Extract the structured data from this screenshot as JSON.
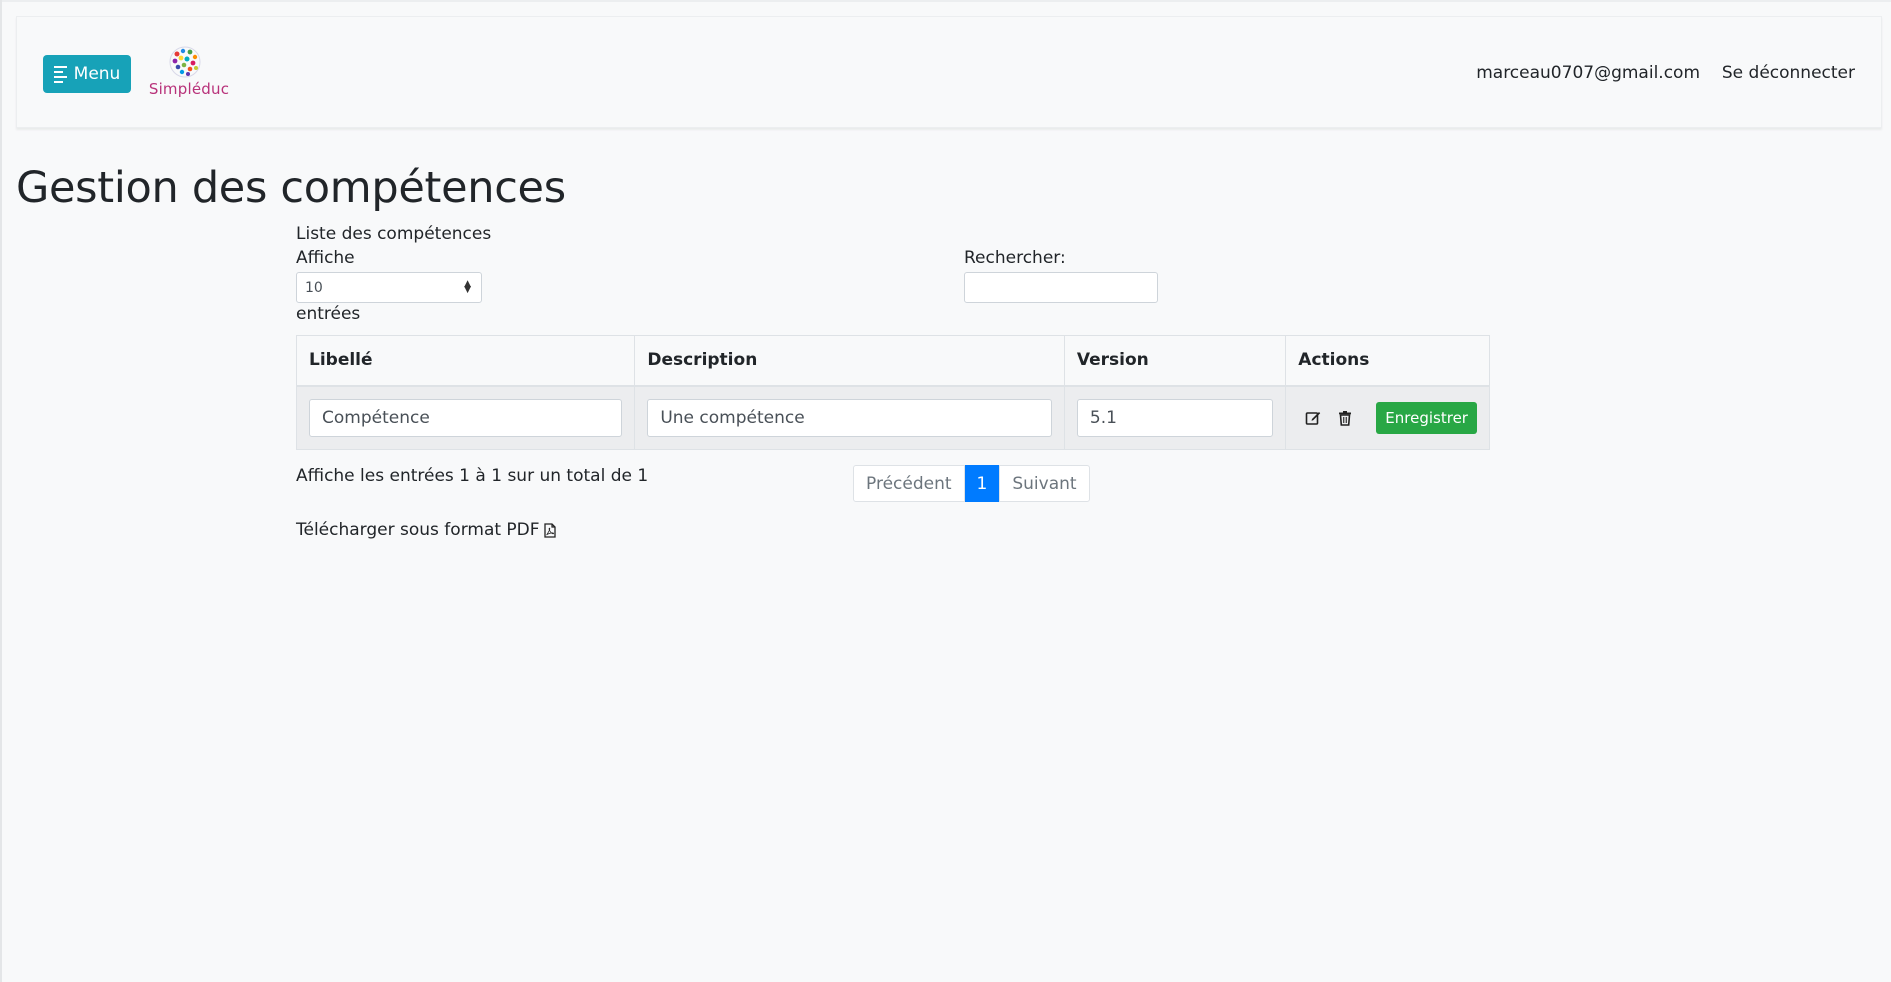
{
  "header": {
    "menu_label": "Menu",
    "logo_text": "Simpléduc",
    "user_email": "marceau0707@gmail.com",
    "logout_label": "Se déconnecter"
  },
  "page": {
    "title": "Gestion des compétences"
  },
  "table_controls": {
    "caption": "Liste des compétences",
    "length_prefix": "Affiche",
    "length_value": "10",
    "length_suffix": "entrées",
    "search_label": "Rechercher:",
    "search_value": ""
  },
  "table": {
    "headers": [
      "Libellé",
      "Description",
      "Version",
      "Actions"
    ],
    "rows": [
      {
        "libelle": "Compétence",
        "description": "Une compétence",
        "version": "5.1",
        "save_label": "Enregistrer"
      }
    ]
  },
  "footer": {
    "info": "Affiche les entrées 1 à 1 sur un total de 1",
    "prev_label": "Précédent",
    "current_page": "1",
    "next_label": "Suivant",
    "pdf_label": "Télécharger sous format PDF"
  },
  "colors": {
    "menu_button": "#17a2b8",
    "save_button": "#28a745",
    "active_page": "#007bff",
    "logo_text": "#b8327a"
  },
  "icons": {
    "menu": "menu-lines-icon",
    "edit": "edit-icon",
    "delete": "trash-icon",
    "pdf": "pdf-file-icon"
  }
}
